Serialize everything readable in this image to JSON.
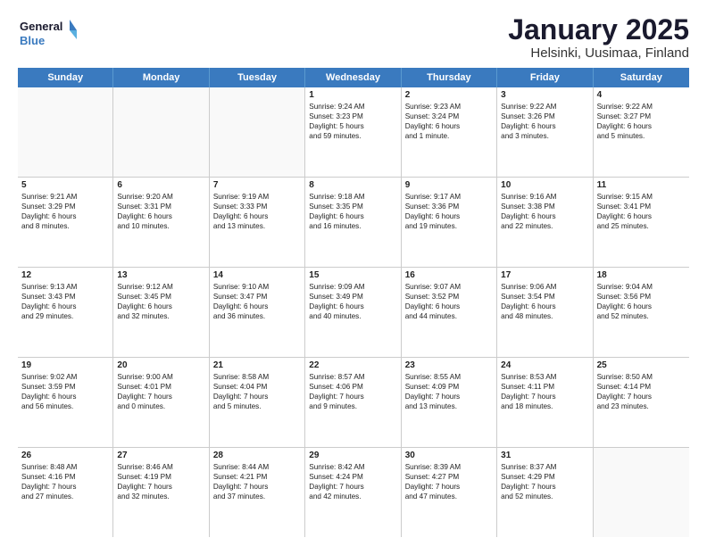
{
  "logo": {
    "line1": "General",
    "line2": "Blue"
  },
  "title": "January 2025",
  "subtitle": "Helsinki, Uusimaa, Finland",
  "days": [
    "Sunday",
    "Monday",
    "Tuesday",
    "Wednesday",
    "Thursday",
    "Friday",
    "Saturday"
  ],
  "weeks": [
    [
      {
        "day": "",
        "info": ""
      },
      {
        "day": "",
        "info": ""
      },
      {
        "day": "",
        "info": ""
      },
      {
        "day": "1",
        "info": "Sunrise: 9:24 AM\nSunset: 3:23 PM\nDaylight: 5 hours\nand 59 minutes."
      },
      {
        "day": "2",
        "info": "Sunrise: 9:23 AM\nSunset: 3:24 PM\nDaylight: 6 hours\nand 1 minute."
      },
      {
        "day": "3",
        "info": "Sunrise: 9:22 AM\nSunset: 3:26 PM\nDaylight: 6 hours\nand 3 minutes."
      },
      {
        "day": "4",
        "info": "Sunrise: 9:22 AM\nSunset: 3:27 PM\nDaylight: 6 hours\nand 5 minutes."
      }
    ],
    [
      {
        "day": "5",
        "info": "Sunrise: 9:21 AM\nSunset: 3:29 PM\nDaylight: 6 hours\nand 8 minutes."
      },
      {
        "day": "6",
        "info": "Sunrise: 9:20 AM\nSunset: 3:31 PM\nDaylight: 6 hours\nand 10 minutes."
      },
      {
        "day": "7",
        "info": "Sunrise: 9:19 AM\nSunset: 3:33 PM\nDaylight: 6 hours\nand 13 minutes."
      },
      {
        "day": "8",
        "info": "Sunrise: 9:18 AM\nSunset: 3:35 PM\nDaylight: 6 hours\nand 16 minutes."
      },
      {
        "day": "9",
        "info": "Sunrise: 9:17 AM\nSunset: 3:36 PM\nDaylight: 6 hours\nand 19 minutes."
      },
      {
        "day": "10",
        "info": "Sunrise: 9:16 AM\nSunset: 3:38 PM\nDaylight: 6 hours\nand 22 minutes."
      },
      {
        "day": "11",
        "info": "Sunrise: 9:15 AM\nSunset: 3:41 PM\nDaylight: 6 hours\nand 25 minutes."
      }
    ],
    [
      {
        "day": "12",
        "info": "Sunrise: 9:13 AM\nSunset: 3:43 PM\nDaylight: 6 hours\nand 29 minutes."
      },
      {
        "day": "13",
        "info": "Sunrise: 9:12 AM\nSunset: 3:45 PM\nDaylight: 6 hours\nand 32 minutes."
      },
      {
        "day": "14",
        "info": "Sunrise: 9:10 AM\nSunset: 3:47 PM\nDaylight: 6 hours\nand 36 minutes."
      },
      {
        "day": "15",
        "info": "Sunrise: 9:09 AM\nSunset: 3:49 PM\nDaylight: 6 hours\nand 40 minutes."
      },
      {
        "day": "16",
        "info": "Sunrise: 9:07 AM\nSunset: 3:52 PM\nDaylight: 6 hours\nand 44 minutes."
      },
      {
        "day": "17",
        "info": "Sunrise: 9:06 AM\nSunset: 3:54 PM\nDaylight: 6 hours\nand 48 minutes."
      },
      {
        "day": "18",
        "info": "Sunrise: 9:04 AM\nSunset: 3:56 PM\nDaylight: 6 hours\nand 52 minutes."
      }
    ],
    [
      {
        "day": "19",
        "info": "Sunrise: 9:02 AM\nSunset: 3:59 PM\nDaylight: 6 hours\nand 56 minutes."
      },
      {
        "day": "20",
        "info": "Sunrise: 9:00 AM\nSunset: 4:01 PM\nDaylight: 7 hours\nand 0 minutes."
      },
      {
        "day": "21",
        "info": "Sunrise: 8:58 AM\nSunset: 4:04 PM\nDaylight: 7 hours\nand 5 minutes."
      },
      {
        "day": "22",
        "info": "Sunrise: 8:57 AM\nSunset: 4:06 PM\nDaylight: 7 hours\nand 9 minutes."
      },
      {
        "day": "23",
        "info": "Sunrise: 8:55 AM\nSunset: 4:09 PM\nDaylight: 7 hours\nand 13 minutes."
      },
      {
        "day": "24",
        "info": "Sunrise: 8:53 AM\nSunset: 4:11 PM\nDaylight: 7 hours\nand 18 minutes."
      },
      {
        "day": "25",
        "info": "Sunrise: 8:50 AM\nSunset: 4:14 PM\nDaylight: 7 hours\nand 23 minutes."
      }
    ],
    [
      {
        "day": "26",
        "info": "Sunrise: 8:48 AM\nSunset: 4:16 PM\nDaylight: 7 hours\nand 27 minutes."
      },
      {
        "day": "27",
        "info": "Sunrise: 8:46 AM\nSunset: 4:19 PM\nDaylight: 7 hours\nand 32 minutes."
      },
      {
        "day": "28",
        "info": "Sunrise: 8:44 AM\nSunset: 4:21 PM\nDaylight: 7 hours\nand 37 minutes."
      },
      {
        "day": "29",
        "info": "Sunrise: 8:42 AM\nSunset: 4:24 PM\nDaylight: 7 hours\nand 42 minutes."
      },
      {
        "day": "30",
        "info": "Sunrise: 8:39 AM\nSunset: 4:27 PM\nDaylight: 7 hours\nand 47 minutes."
      },
      {
        "day": "31",
        "info": "Sunrise: 8:37 AM\nSunset: 4:29 PM\nDaylight: 7 hours\nand 52 minutes."
      },
      {
        "day": "",
        "info": ""
      }
    ]
  ]
}
